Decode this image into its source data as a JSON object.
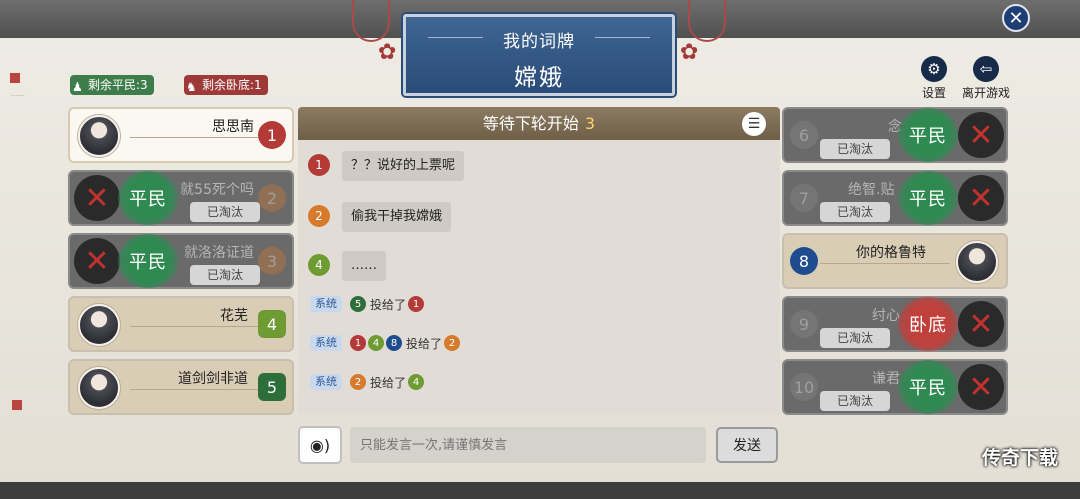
{
  "card": {
    "title": "我的词牌",
    "word": "嫦娥"
  },
  "remaining": {
    "civilian": "剩余平民:3",
    "undercover": "剩余卧底:1"
  },
  "top_buttons": {
    "settings": "设置",
    "leave": "离开游戏"
  },
  "chat": {
    "header": "等待下轮开始",
    "countdown": "3",
    "messages": [
      {
        "num": "1",
        "text": "？？说好的上票呢"
      },
      {
        "num": "2",
        "text": "偷我干掉我嫦娥"
      },
      {
        "num": "4",
        "text": "……"
      }
    ],
    "system_tag": "系统",
    "votes": [
      {
        "voters": [
          "5"
        ],
        "verb": "投给了",
        "target": "1"
      },
      {
        "voters": [
          "1",
          "4",
          "8"
        ],
        "verb": "投给了",
        "target": "2"
      },
      {
        "voters": [
          "2"
        ],
        "verb": "投给了",
        "target": "4"
      }
    ]
  },
  "input": {
    "placeholder": "只能发言一次,请谨慎发言",
    "send_label": "发送"
  },
  "eliminated_label": "已淘汰",
  "roles": {
    "civilian": "平民",
    "undercover": "卧底"
  },
  "left_players": [
    {
      "num": "1",
      "name": "思思南"
    },
    {
      "num": "2",
      "name": "就55死个吗",
      "role": "平民"
    },
    {
      "num": "3",
      "name": "就洛洛证道",
      "role": "平民"
    },
    {
      "num": "4",
      "name": "花芜"
    },
    {
      "num": "5",
      "name": "道剑剑非道"
    }
  ],
  "right_players": [
    {
      "num": "6",
      "name": "念",
      "role": "平民"
    },
    {
      "num": "7",
      "name": "绝智.贴",
      "role": "平民"
    },
    {
      "num": "8",
      "name": "你的格鲁特"
    },
    {
      "num": "9",
      "name": "纣心",
      "role": "卧底"
    },
    {
      "num": "10",
      "name": "谦君",
      "role": "平民"
    }
  ],
  "watermark": "传奇下载",
  "colors": {
    "civilian": "#2f8a52",
    "undercover": "#c0403c",
    "banner": "#2a4c79"
  }
}
